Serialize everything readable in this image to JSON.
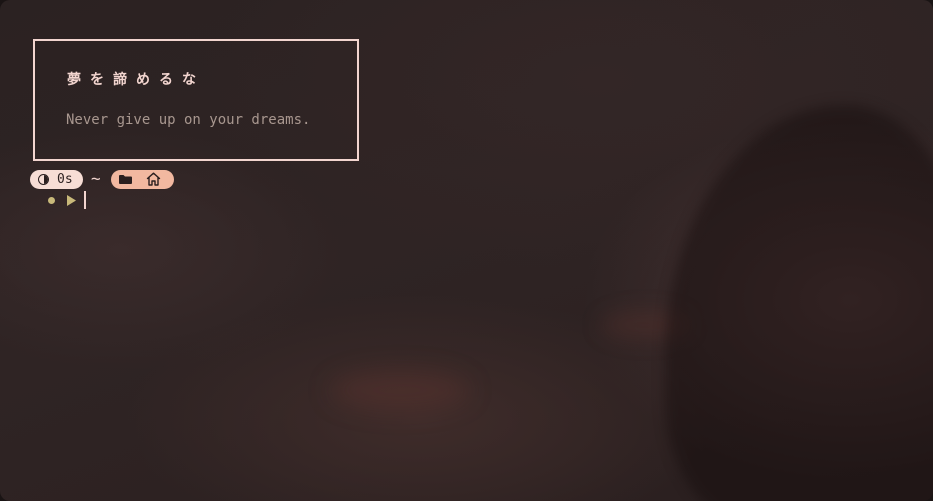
{
  "banner": {
    "title": "夢を諦めるな",
    "subtitle": "Never give up on your dreams."
  },
  "prompt": {
    "duration": "0s",
    "separator": "~",
    "timer_icon": "timer-icon",
    "folder_icon": "folder-icon",
    "home_icon": "home-icon",
    "status_icon": "status-dot-icon",
    "prompt_icon": "prompt-arrow-icon"
  },
  "colors": {
    "text_light": "#f2d5cf",
    "subtle_text": "#a8978f",
    "time_pill": "#f7ddd5",
    "dir_pill": "#f2b8a0",
    "status_dot": "#c8b97a",
    "background": "#2b2222"
  }
}
